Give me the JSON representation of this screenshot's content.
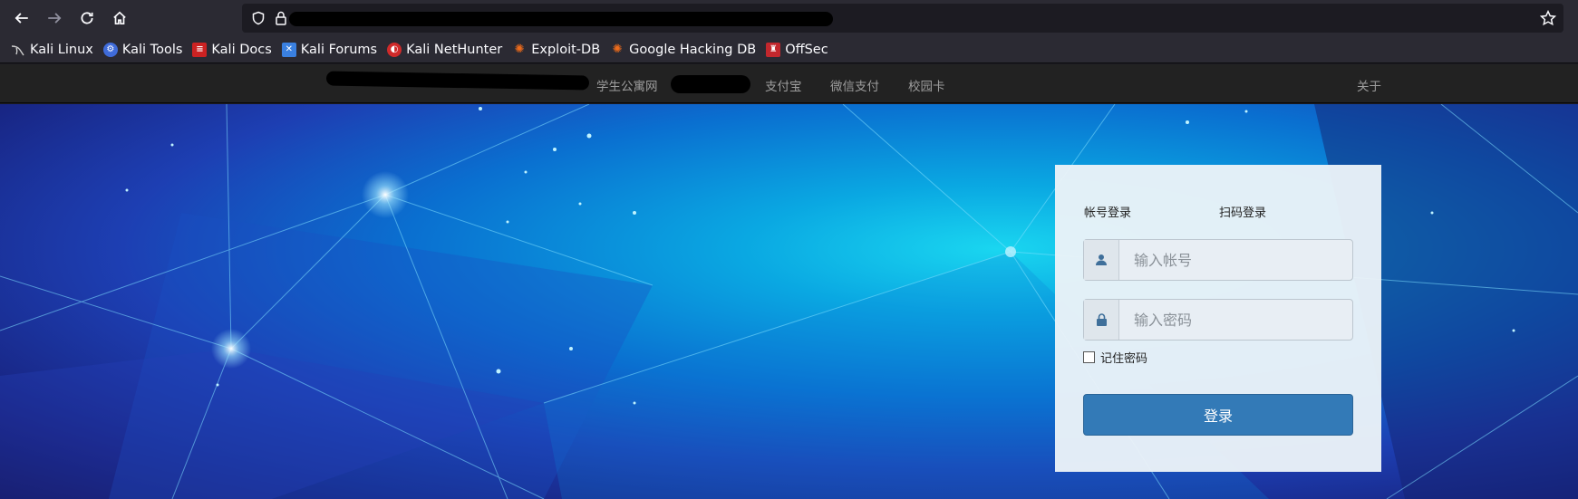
{
  "browser": {
    "nav": {
      "back": "back-icon",
      "forward": "forward-icon",
      "reload": "reload-icon",
      "home": "home-icon"
    },
    "bookmarks": [
      {
        "label": "Kali Linux",
        "icon": "kali-icon"
      },
      {
        "label": "Kali Tools",
        "icon": "kali-tools-icon"
      },
      {
        "label": "Kali Docs",
        "icon": "kali-docs-icon"
      },
      {
        "label": "Kali Forums",
        "icon": "kali-forums-icon"
      },
      {
        "label": "Kali NetHunter",
        "icon": "nethunter-icon"
      },
      {
        "label": "Exploit-DB",
        "icon": "exploit-db-icon"
      },
      {
        "label": "Google Hacking DB",
        "icon": "ghdb-icon"
      },
      {
        "label": "OffSec",
        "icon": "offsec-icon"
      }
    ]
  },
  "site_nav": {
    "links": [
      "学生公寓网",
      "支付宝",
      "微信支付",
      "校园卡"
    ],
    "about": "关于"
  },
  "login": {
    "tabs": [
      "帐号登录",
      "扫码登录"
    ],
    "account_placeholder": "输入帐号",
    "password_placeholder": "输入密码",
    "remember_label": "记住密码",
    "submit_label": "登录"
  },
  "colors": {
    "primary": "#337ab7",
    "navbar": "#222222",
    "toolbar": "#2b2a33"
  }
}
